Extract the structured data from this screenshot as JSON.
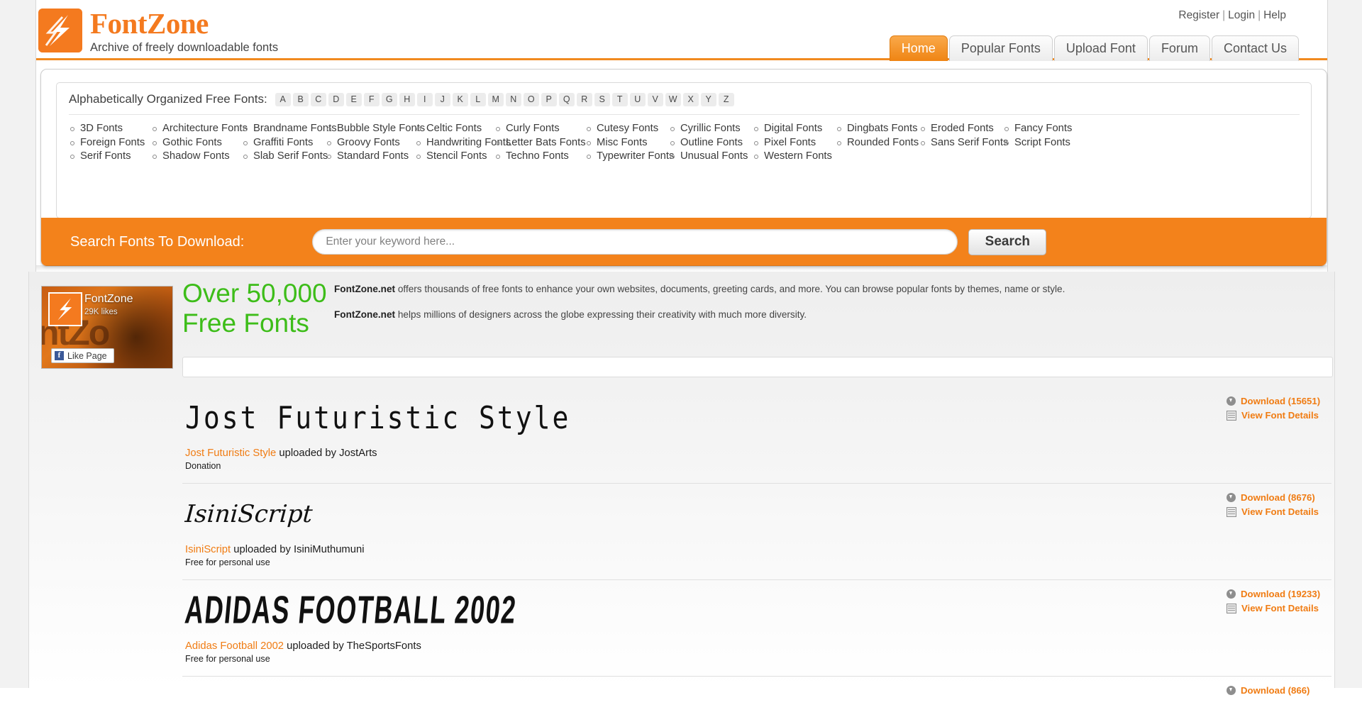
{
  "site": {
    "logo_title": "FontZone",
    "logo_tagline": "Archive of freely downloadable fonts"
  },
  "header": {
    "account_links": [
      {
        "label": "Register"
      },
      {
        "label": "Login"
      },
      {
        "label": "Help"
      }
    ],
    "separator": "|",
    "tabs": [
      {
        "label": "Home",
        "active": true
      },
      {
        "label": "Popular Fonts",
        "active": false
      },
      {
        "label": "Upload Font",
        "active": false
      },
      {
        "label": "Forum",
        "active": false
      },
      {
        "label": "Contact Us",
        "active": false
      }
    ]
  },
  "categories_panel": {
    "alpha_label": "Alphabetically Organized Free Fonts:",
    "letters": [
      "A",
      "B",
      "C",
      "D",
      "E",
      "F",
      "G",
      "H",
      "I",
      "J",
      "K",
      "L",
      "M",
      "N",
      "O",
      "P",
      "Q",
      "R",
      "S",
      "T",
      "U",
      "V",
      "W",
      "X",
      "Y",
      "Z"
    ],
    "columns": [
      [
        "3D Fonts",
        "Foreign Fonts",
        "Serif Fonts"
      ],
      [
        "Architecture Fonts",
        "Gothic Fonts",
        "Shadow Fonts"
      ],
      [
        "Brandname Fonts",
        "Graffiti Fonts",
        "Slab Serif Fonts"
      ],
      [
        "Bubble Style Fonts",
        "Groovy Fonts",
        "Standard Fonts"
      ],
      [
        "Celtic Fonts",
        "Handwriting Fonts",
        "Stencil Fonts"
      ],
      [
        "Curly Fonts",
        "Letter Bats Fonts",
        "Techno Fonts"
      ],
      [
        "Cutesy Fonts",
        "Misc Fonts",
        "Typewriter Fonts"
      ],
      [
        "Cyrillic Fonts",
        "Outline Fonts",
        "Unusual Fonts"
      ],
      [
        "Digital Fonts",
        "Pixel Fonts",
        "Western Fonts"
      ],
      [
        "Dingbats Fonts",
        "Rounded Fonts"
      ],
      [
        "Eroded Fonts",
        "Sans Serif Fonts"
      ],
      [
        "Fancy Fonts",
        "Script Fonts"
      ]
    ]
  },
  "search": {
    "label": "Search Fonts To Download:",
    "placeholder": "Enter your keyword here...",
    "value": "",
    "button_label": "Search"
  },
  "facebook_widget": {
    "page_name": "FontZone",
    "likes": "29K likes",
    "like_button_label": "Like Page",
    "f_glyph": "f",
    "ghost_text": "ntZo"
  },
  "intro": {
    "headline_line1": "Over 50,000",
    "headline_line2": "Free Fonts",
    "paragraph1_brand": "FontZone.net",
    "paragraph1_rest": " offers thousands of free fonts to enhance your own websites, documents, greeting cards, and more. You can browse popular fonts by themes, name or style.",
    "paragraph2_brand": "FontZone.net",
    "paragraph2_rest": " helps millions of designers across the globe expressing their creativity with much more diversity."
  },
  "font_list": {
    "uploaded_by_text": " uploaded by ",
    "download_label_prefix": "Download",
    "details_label": "View Font Details",
    "items": [
      {
        "name": "Jost Futuristic Style",
        "preview_text": "Jost Futuristic Style",
        "uploader": "JostArts",
        "license": "Donation",
        "download_count": "15651",
        "download_label": "Download (15651)",
        "details_label": "View Font Details"
      },
      {
        "name": "IsiniScript",
        "preview_text": "IsiniScript",
        "uploader": "IsiniMuthumuni",
        "license": "Free for personal use",
        "download_count": "8676",
        "download_label": "Download (8676)",
        "details_label": "View Font Details"
      },
      {
        "name": "Adidas Football 2002",
        "preview_text": "ADIDAS FOOTBALL 2002",
        "uploader": "TheSportsFonts",
        "license": "Free for personal use",
        "download_count": "19233",
        "download_label": "Download (19233)",
        "details_label": "View Font Details"
      },
      {
        "name": "",
        "preview_text": "",
        "uploader": "",
        "license": "",
        "download_count": "866",
        "download_label": "Download (866)",
        "details_label": ""
      }
    ]
  },
  "colors": {
    "brand_orange": "#f47a1f",
    "link_orange": "#f07c13",
    "green": "#3dbd19",
    "search_bar": "#f3821b"
  }
}
